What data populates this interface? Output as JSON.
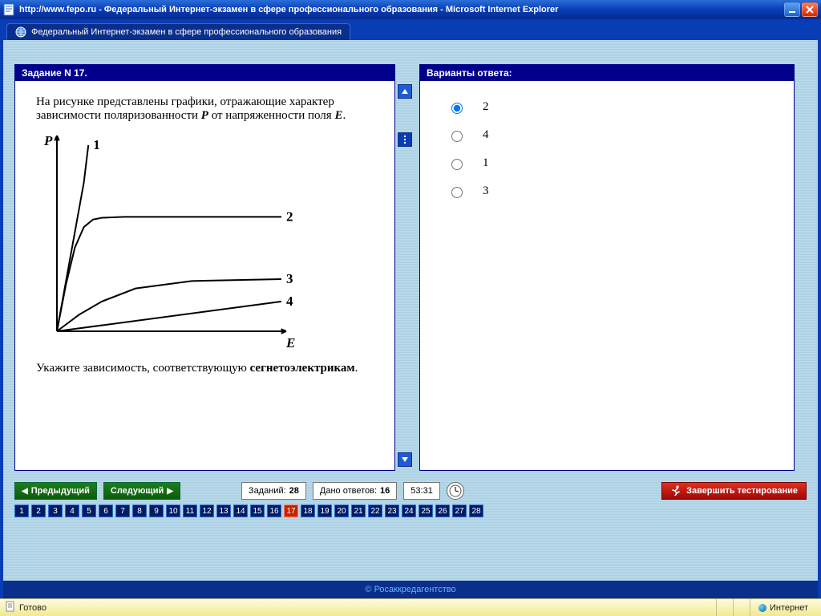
{
  "window": {
    "title": "http://www.fepo.ru - Федеральный Интернет-экзамен в сфере профессионального образования - Microsoft Internet Explorer"
  },
  "tab": {
    "title": "Федеральный Интернет-экзамен в сфере профессионального образования"
  },
  "question": {
    "header": "Задание N 17.",
    "text1_a": "На рисунке представлены графики, отражающие характер зависимости поляризованности ",
    "text1_p": "P",
    "text1_b": " от напряженности поля ",
    "text1_e": "E",
    "text1_c": ".",
    "text2_a": "Укажите зависимость, соответствующую ",
    "text2_b": "сегнетоэлектрикам",
    "text2_c": "."
  },
  "chart_data": {
    "type": "line",
    "xlabel": "E",
    "ylabel": "P",
    "xlim": [
      0,
      10
    ],
    "ylim": [
      0,
      10
    ],
    "series": [
      {
        "name": "1",
        "x": [
          0,
          0.3,
          0.6,
          0.9,
          1.2,
          1.4
        ],
        "y": [
          0,
          2.0,
          4.0,
          6.0,
          8.0,
          10.0
        ]
      },
      {
        "name": "2",
        "x": [
          0,
          0.4,
          0.8,
          1.2,
          1.6,
          2.0,
          3.0,
          10.0
        ],
        "y": [
          0,
          2.5,
          4.5,
          5.6,
          6.0,
          6.1,
          6.15,
          6.15
        ]
      },
      {
        "name": "3",
        "x": [
          0,
          1.0,
          2.0,
          3.5,
          6.0,
          10.0
        ],
        "y": [
          0,
          0.9,
          1.6,
          2.3,
          2.7,
          2.8
        ]
      },
      {
        "name": "4",
        "x": [
          0,
          10.0
        ],
        "y": [
          0,
          1.6
        ]
      }
    ]
  },
  "answers": {
    "header": "Варианты ответа:",
    "options": [
      "2",
      "4",
      "1",
      "3"
    ],
    "selected_index": 0
  },
  "nav": {
    "prev": "Предыдущий",
    "next": "Следующий",
    "tasks_label": "Заданий:",
    "tasks_count": "28",
    "answered_label": "Дано ответов:",
    "answered_count": "16",
    "timer": "53:31",
    "finish": "Завершить тестирование"
  },
  "question_numbers": {
    "total": 28,
    "current": 17
  },
  "footer": {
    "credit": "© Росаккредагентство"
  },
  "statusbar": {
    "ready": "Готово",
    "zone": "Интернет"
  }
}
